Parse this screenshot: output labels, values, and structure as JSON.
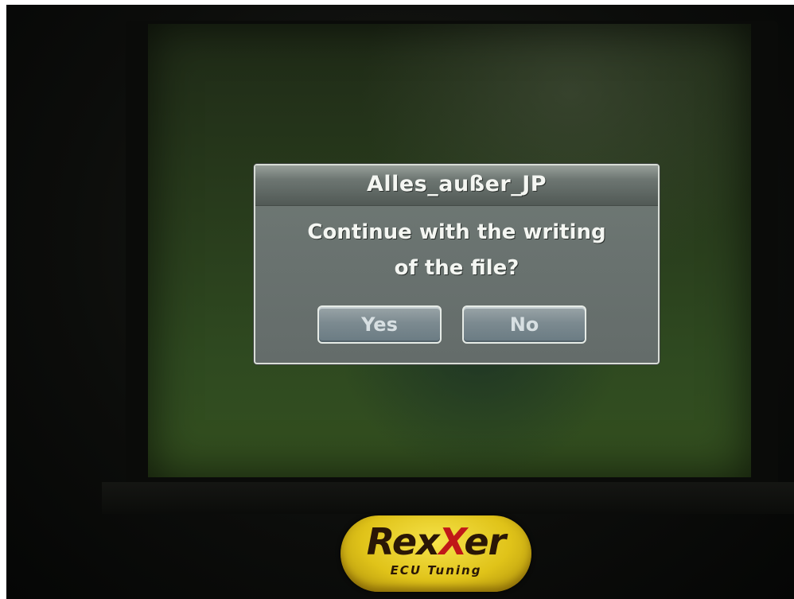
{
  "dialog": {
    "title": "Alles_außer_JP",
    "message_line1": "Continue with the writing",
    "message_line2": "of the file?",
    "yes_label": "Yes",
    "no_label": "No"
  },
  "device_logo": {
    "brand_prefix": "Rex",
    "brand_x": "X",
    "brand_suffix": "er",
    "tagline": "ECU Tuning"
  },
  "colors": {
    "screen_green": "#2f4a20",
    "dialog_gray": "#6a7370",
    "logo_yellow": "#e0c319",
    "logo_red": "#c01818"
  }
}
